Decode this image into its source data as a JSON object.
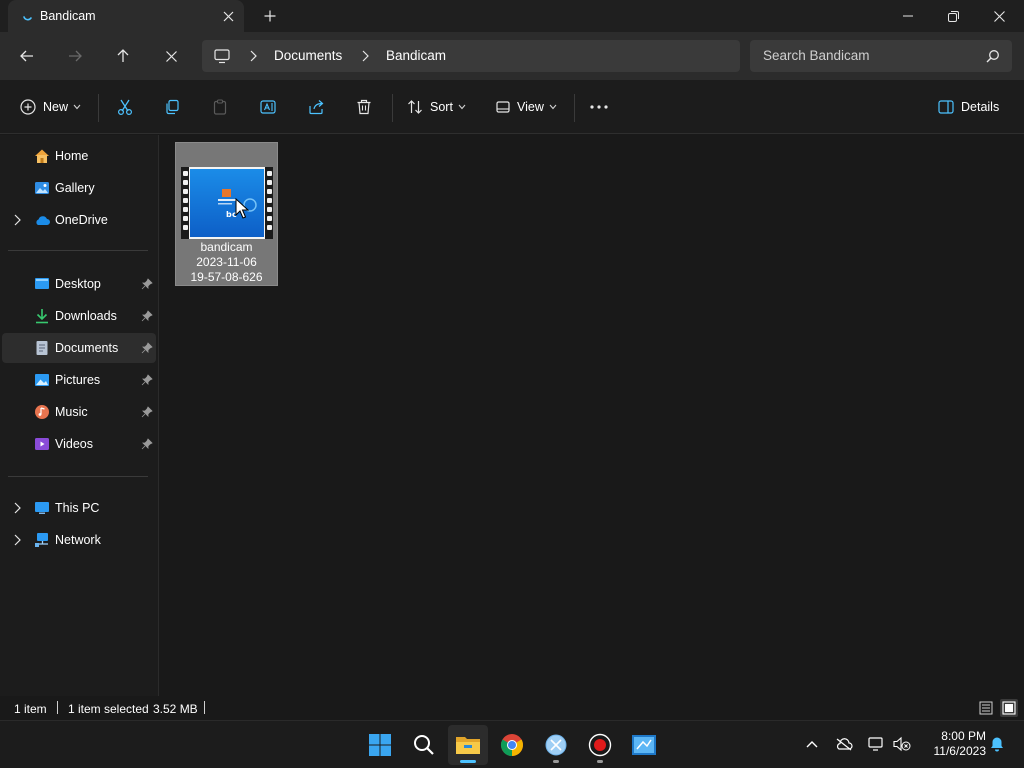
{
  "window": {
    "tab_title": "Bandicam",
    "minimize_icon": "minimize-icon",
    "restore_icon": "restore-icon",
    "close_icon": "close-icon"
  },
  "address": {
    "crumbs": [
      "Documents",
      "Bandicam"
    ],
    "search_placeholder": "Search Bandicam"
  },
  "commands": {
    "new_label": "New",
    "sort_label": "Sort",
    "view_label": "View",
    "details_label": "Details"
  },
  "sidebar": {
    "items": [
      {
        "label": "Home",
        "icon": "home-icon"
      },
      {
        "label": "Gallery",
        "icon": "gallery-icon"
      },
      {
        "label": "OneDrive",
        "icon": "onedrive-icon"
      },
      {
        "label": "Desktop",
        "icon": "desktop-icon",
        "pinned": true
      },
      {
        "label": "Downloads",
        "icon": "downloads-icon",
        "pinned": true
      },
      {
        "label": "Documents",
        "icon": "documents-icon",
        "pinned": true,
        "selected": true
      },
      {
        "label": "Pictures",
        "icon": "pictures-icon",
        "pinned": true
      },
      {
        "label": "Music",
        "icon": "music-icon",
        "pinned": true
      },
      {
        "label": "Videos",
        "icon": "videos-icon",
        "pinned": true
      },
      {
        "label": "This PC",
        "icon": "this-pc-icon"
      },
      {
        "label": "Network",
        "icon": "network-icon"
      }
    ]
  },
  "files": [
    {
      "name_lines": [
        "bandicam",
        "2023-11-06",
        "19-57-08-626"
      ],
      "selected": true
    }
  ],
  "status": {
    "item_count": "1 item",
    "selection": "1 item selected",
    "size": "3.52 MB"
  },
  "taskbar": {
    "time": "8:00 PM",
    "date": "11/6/2023"
  },
  "colors": {
    "accent": "#4cc2ff",
    "selection_tile": "#777777"
  }
}
